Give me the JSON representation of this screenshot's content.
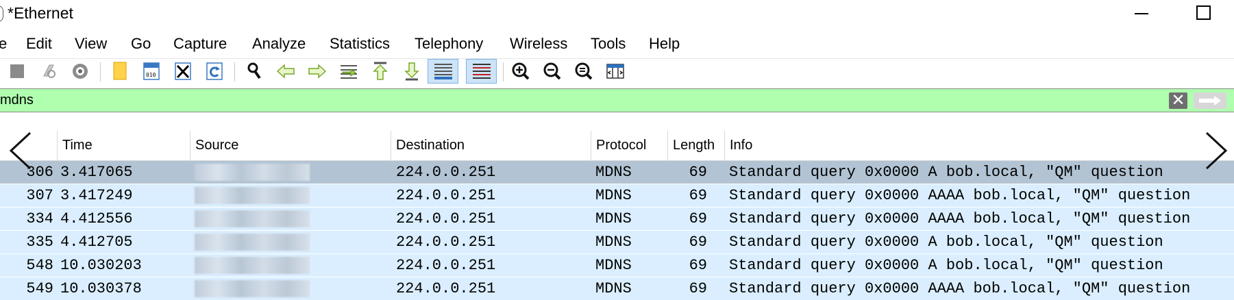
{
  "window": {
    "title": "*Ethernet"
  },
  "menu": [
    "e",
    "Edit",
    "View",
    "Go",
    "Capture",
    "Analyze",
    "Statistics",
    "Telephony",
    "Wireless",
    "Tools",
    "Help"
  ],
  "toolbar": {
    "icons": [
      "stop-capture-icon",
      "restart-capture-icon",
      "capture-options-icon",
      "open-file-icon",
      "save-file-icon",
      "close-file-icon",
      "reload-file-icon",
      "find-packet-icon",
      "go-back-icon",
      "go-forward-icon",
      "go-to-packet-icon",
      "first-packet-icon",
      "last-packet-icon",
      "auto-scroll-icon",
      "colorize-icon",
      "zoom-in-icon",
      "zoom-out-icon",
      "normal-size-icon",
      "resize-columns-icon"
    ]
  },
  "filter": {
    "value": "mdns",
    "bg_color": "#afffaf"
  },
  "columns": [
    "Time",
    "Source",
    "Destination",
    "Protocol",
    "Length",
    "Info"
  ],
  "packets": [
    {
      "no": "306",
      "time": "3.417065",
      "destination": "224.0.0.251",
      "protocol": "MDNS",
      "length": "69",
      "info": "Standard query 0x0000 A bob.local, \"QM\" question"
    },
    {
      "no": "307",
      "time": "3.417249",
      "destination": "224.0.0.251",
      "protocol": "MDNS",
      "length": "69",
      "info": "Standard query 0x0000 AAAA bob.local, \"QM\" question"
    },
    {
      "no": "334",
      "time": "4.412556",
      "destination": "224.0.0.251",
      "protocol": "MDNS",
      "length": "69",
      "info": "Standard query 0x0000 AAAA bob.local, \"QM\" question"
    },
    {
      "no": "335",
      "time": "4.412705",
      "destination": "224.0.0.251",
      "protocol": "MDNS",
      "length": "69",
      "info": "Standard query 0x0000 A bob.local, \"QM\" question"
    },
    {
      "no": "548",
      "time": "10.030203",
      "destination": "224.0.0.251",
      "protocol": "MDNS",
      "length": "69",
      "info": "Standard query 0x0000 A bob.local, \"QM\" question"
    },
    {
      "no": "549",
      "time": "10.030378",
      "destination": "224.0.0.251",
      "protocol": "MDNS",
      "length": "69",
      "info": "Standard query 0x0000 AAAA bob.local, \"QM\" question"
    }
  ],
  "colors": {
    "row_bg": "#daeeff",
    "selected_row_bg": "#b2c4d4"
  }
}
